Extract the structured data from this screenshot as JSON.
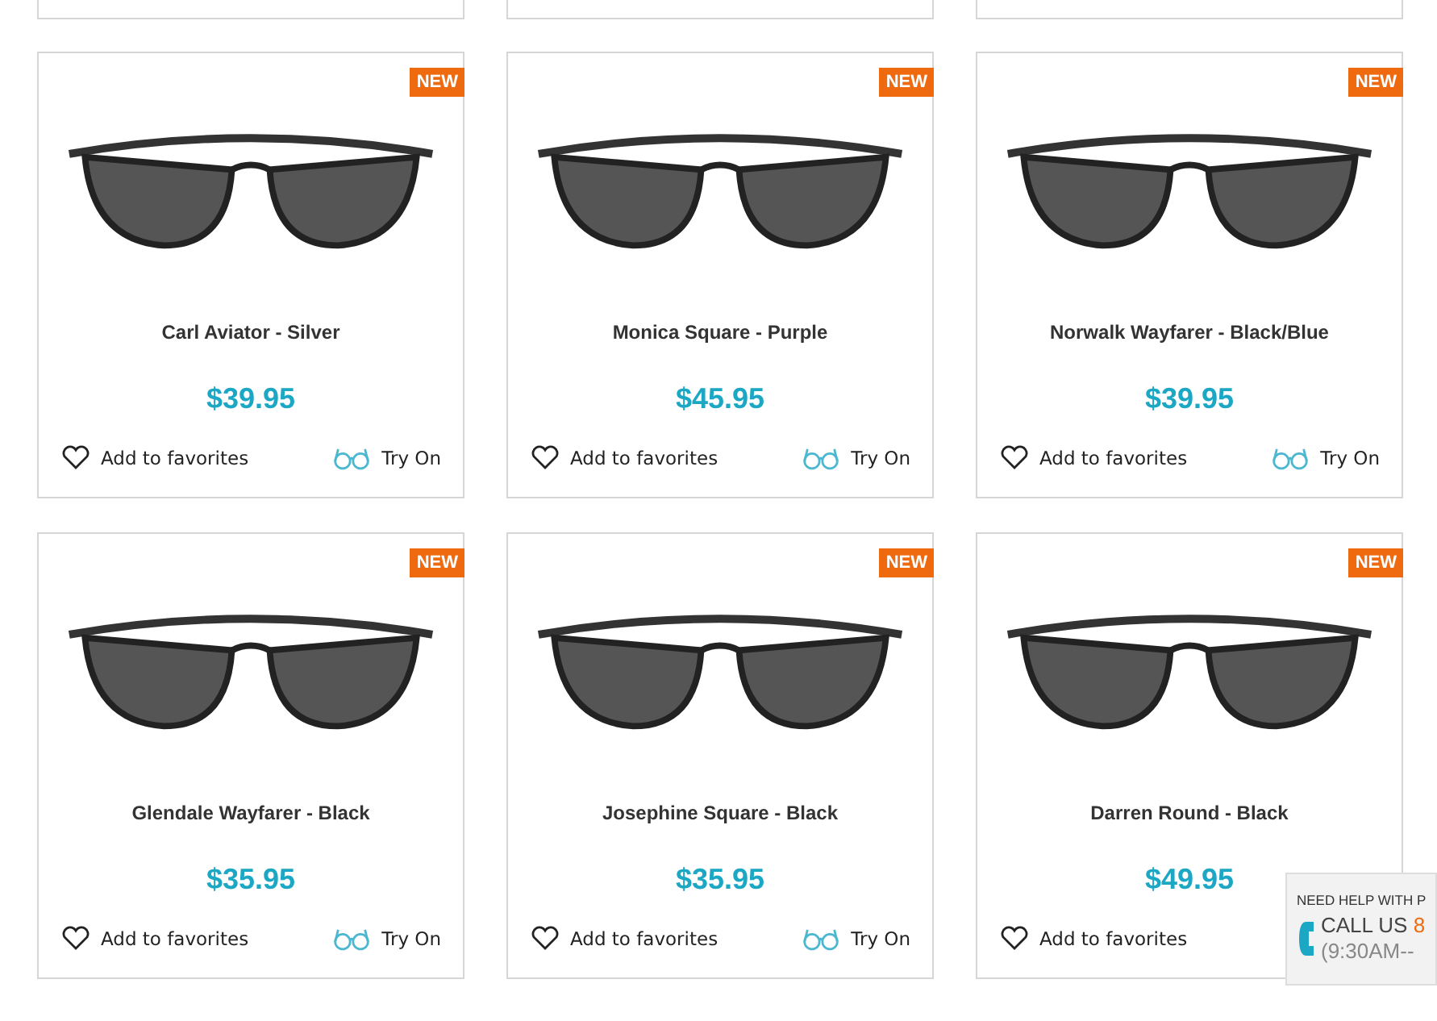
{
  "products": [
    {
      "name": "Carl Aviator - Silver",
      "price": "$39.95",
      "badge": "NEW",
      "favorite_label": "Add to favorites",
      "try_on_label": "Try On"
    },
    {
      "name": "Monica Square - Purple",
      "price": "$45.95",
      "badge": "NEW",
      "favorite_label": "Add to favorites",
      "try_on_label": "Try On"
    },
    {
      "name": "Norwalk Wayfarer - Black/Blue",
      "price": "$39.95",
      "badge": "NEW",
      "favorite_label": "Add to favorites",
      "try_on_label": "Try On"
    },
    {
      "name": "Glendale Wayfarer - Black",
      "price": "$35.95",
      "badge": "NEW",
      "favorite_label": "Add to favorites",
      "try_on_label": "Try On"
    },
    {
      "name": "Josephine Square - Black",
      "price": "$35.95",
      "badge": "NEW",
      "favorite_label": "Add to favorites",
      "try_on_label": "Try On"
    },
    {
      "name": "Darren Round - Black",
      "price": "$49.95",
      "badge": "NEW",
      "favorite_label": "Add to favorites"
    }
  ],
  "help_widget": {
    "heading": "NEED HELP WITH P",
    "call_label": "CALL US",
    "phone": "8",
    "hours": "(9:30AM--"
  }
}
